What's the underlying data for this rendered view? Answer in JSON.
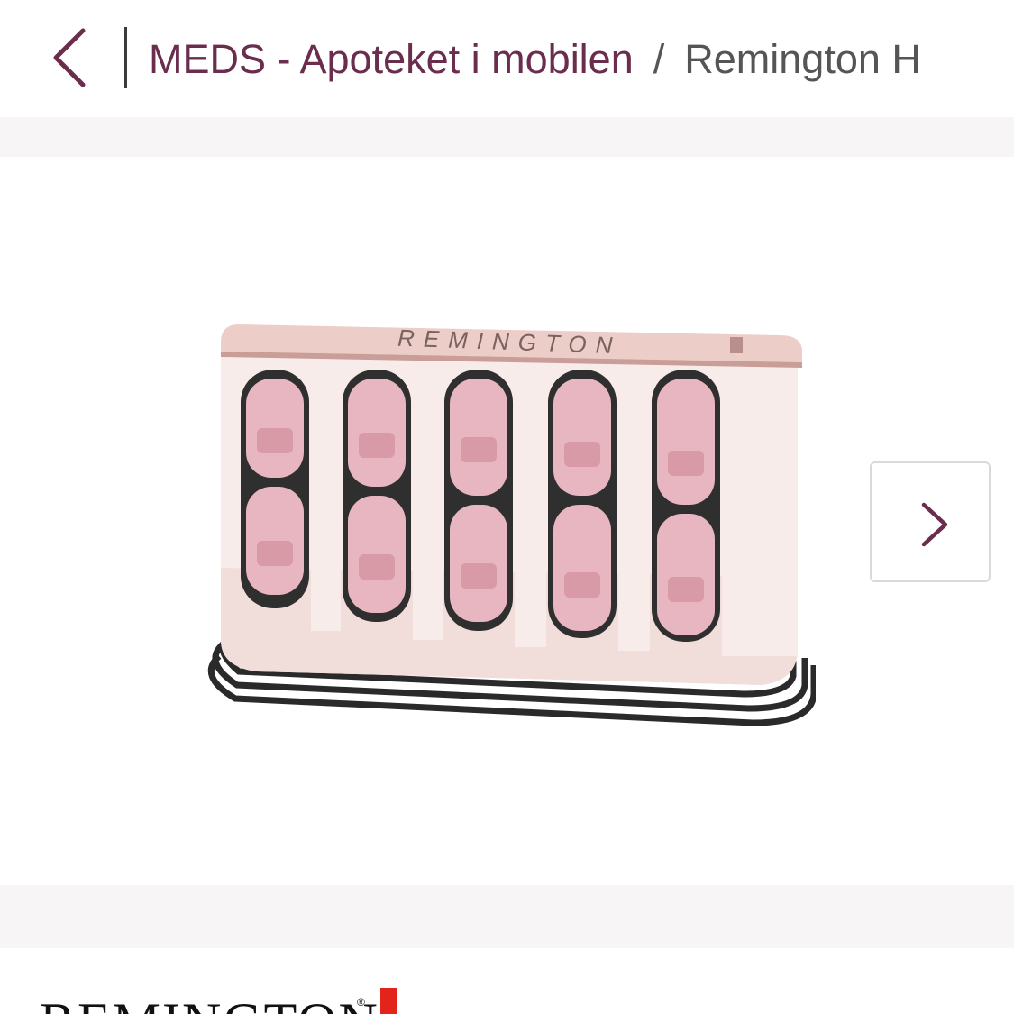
{
  "header": {
    "back_icon": "chevron-left-icon",
    "breadcrumb": [
      {
        "label": "MEDS - Apoteket i mobilen"
      },
      {
        "label": "Remington H"
      }
    ],
    "separator": "/"
  },
  "gallery": {
    "product_alt": "Remington hot rollers set",
    "image_brand_text": "REMINGTON",
    "next_icon": "chevron-right-icon"
  },
  "brand": {
    "logo_text": "REMINGTON",
    "logo_mark": "®"
  },
  "colors": {
    "accent": "#6a2d4d",
    "rose": "#e8b6c0",
    "brand_red": "#e3241b"
  }
}
